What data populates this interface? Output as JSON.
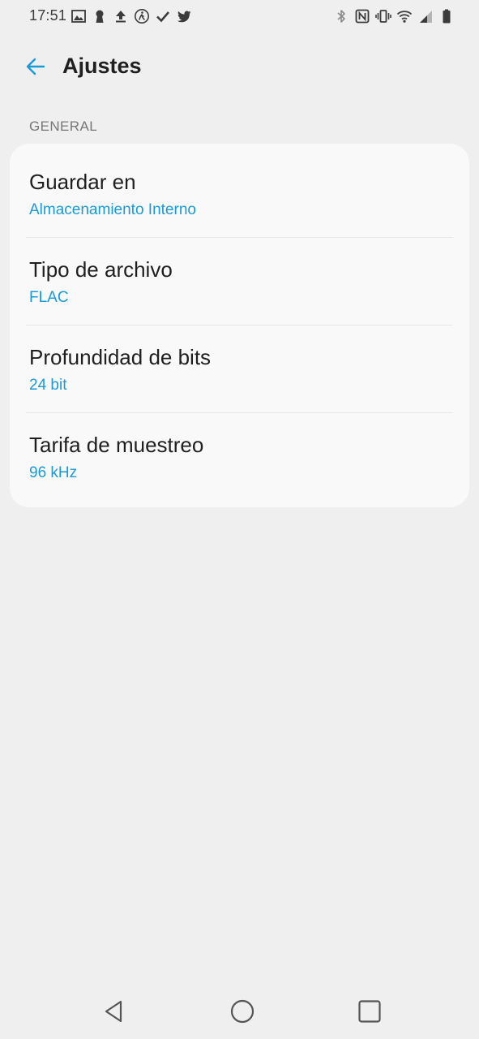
{
  "status_bar": {
    "time": "17:51",
    "left_icons": [
      "image-icon",
      "keyhole-icon",
      "upload-icon",
      "walk-icon",
      "check-icon",
      "twitter-icon"
    ],
    "right_icons": [
      "bluetooth-icon",
      "nfc-icon",
      "vibrate-icon",
      "wifi-icon",
      "cell-signal-icon",
      "battery-icon"
    ]
  },
  "app_bar": {
    "back_icon": "arrow-back-icon",
    "title": "Ajustes"
  },
  "section": {
    "header": "GENERAL"
  },
  "settings": [
    {
      "title": "Guardar en",
      "value": "Almacenamiento Interno"
    },
    {
      "title": "Tipo de archivo",
      "value": "FLAC"
    },
    {
      "title": "Profundidad de bits",
      "value": "24 bit"
    },
    {
      "title": "Tarifa de muestreo",
      "value": "96 kHz"
    }
  ],
  "nav_bar": {
    "back_icon": "nav-back-icon",
    "home_icon": "nav-home-icon",
    "recents_icon": "nav-recents-icon"
  },
  "colors": {
    "accent": "#1a9ad6",
    "background": "#efefef",
    "card": "#f9f9f9"
  }
}
